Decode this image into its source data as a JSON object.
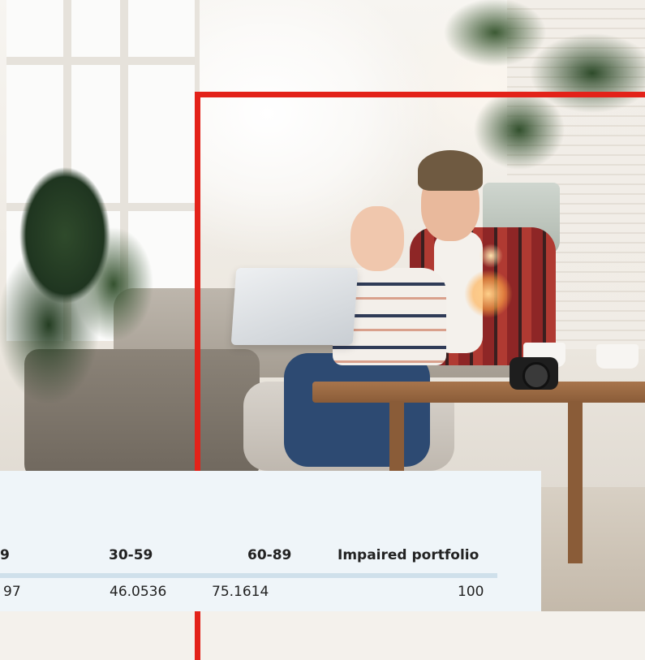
{
  "background_photo": {
    "description_icon": "photo-couple-with-laptop",
    "accent_color": "#e32219"
  },
  "table": {
    "columns": [
      "9",
      "30-59",
      "60-89",
      "Impaired portfolio"
    ],
    "rows": [
      [
        "97",
        "46.0536",
        "75.1614",
        "100"
      ]
    ],
    "divider_color": "#cfe0eb",
    "card_color": "#eff5f9"
  }
}
